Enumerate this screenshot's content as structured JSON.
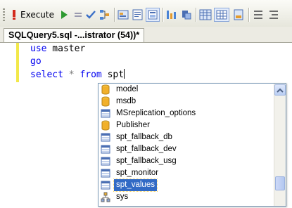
{
  "toolbar": {
    "execute_label": "Execute",
    "icons": [
      "execute-icon",
      "debug-play-icon",
      "stop-icon",
      "parse-check-icon",
      "display-plan-icon",
      "query-designer-icon",
      "results-to-text-icon",
      "include-statistics-icon",
      "client-stats-icon",
      "results-to-grid-icon",
      "results-to-file-icon",
      "comment-icon",
      "uncomment-icon"
    ]
  },
  "editor": {
    "tab_title": "SQLQuery5.sql -...istrator (54))*",
    "lines": {
      "l1_kw": "use",
      "l1_rest": " master",
      "l2_kw": "go",
      "l3_kw1": "select",
      "l3_mid": " * ",
      "l3_kw2": "from",
      "l3_rest": " spt"
    }
  },
  "intellisense": {
    "items": [
      {
        "label": "model",
        "icon": "database-icon"
      },
      {
        "label": "msdb",
        "icon": "database-icon"
      },
      {
        "label": "MSreplication_options",
        "icon": "table-icon"
      },
      {
        "label": "Publisher",
        "icon": "database-icon"
      },
      {
        "label": "spt_fallback_db",
        "icon": "table-icon"
      },
      {
        "label": "spt_fallback_dev",
        "icon": "table-icon"
      },
      {
        "label": "spt_fallback_usg",
        "icon": "table-icon"
      },
      {
        "label": "spt_monitor",
        "icon": "table-icon"
      },
      {
        "label": "spt_values",
        "icon": "table-icon",
        "selected": true
      },
      {
        "label": "sys",
        "icon": "schema-icon"
      }
    ],
    "scroll_position": 0.85
  },
  "colors": {
    "keyword": "#0000f0",
    "selection": "#316ac5",
    "margin_marker": "#f2e84a"
  }
}
